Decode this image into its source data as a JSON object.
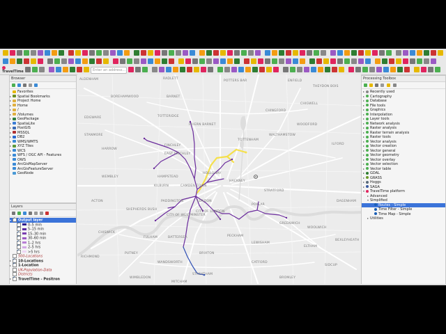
{
  "app": {
    "logo_text": "TravelTime",
    "address_placeholder": "Enter an address..."
  },
  "browser": {
    "title": "Browser",
    "items": [
      {
        "label": "Favorites",
        "icon": "star-icon",
        "color": "#e6b800",
        "arrow": ""
      },
      {
        "label": "Spatial Bookmarks",
        "icon": "bookmark-icon",
        "color": "#6b8e23",
        "arrow": "▸"
      },
      {
        "label": "Project Home",
        "icon": "folder-icon",
        "color": "#e0b040",
        "arrow": "▸"
      },
      {
        "label": "Home",
        "icon": "folder-icon",
        "color": "#e0b040",
        "arrow": "▸"
      },
      {
        "label": "/",
        "icon": "folder-icon",
        "color": "#e0b040",
        "arrow": "▸"
      },
      {
        "label": "/Volumes",
        "icon": "folder-icon",
        "color": "#e0b040",
        "arrow": "▸"
      },
      {
        "label": "GeoPackage",
        "icon": "geopackage-icon",
        "color": "#2f7f3f",
        "arrow": "▸"
      },
      {
        "label": "SpatiaLite",
        "icon": "spatialite-icon",
        "color": "#3a7dd6",
        "arrow": "▸"
      },
      {
        "label": "PostGIS",
        "icon": "elephant-icon",
        "color": "#3a6bb5",
        "arrow": "▸"
      },
      {
        "label": "MSSQL",
        "icon": "database-icon",
        "color": "#b03030",
        "arrow": "▸"
      },
      {
        "label": "DB2",
        "icon": "database-icon",
        "color": "#2a6ad0",
        "arrow": "▸"
      },
      {
        "label": "WMS/WMTS",
        "icon": "globe-icon",
        "color": "#3a8ad6",
        "arrow": "▸"
      },
      {
        "label": "XYZ Tiles",
        "icon": "grid-icon",
        "color": "#5a9a3a",
        "arrow": "▸"
      },
      {
        "label": "WCS",
        "icon": "globe-icon",
        "color": "#3a8ad6",
        "arrow": "▸"
      },
      {
        "label": "WFS / OGC API - Features",
        "icon": "globe-icon",
        "color": "#3a8ad6",
        "arrow": "▸"
      },
      {
        "label": "OWS",
        "icon": "globe-icon",
        "color": "#3a8ad6",
        "arrow": ""
      },
      {
        "label": "ArcGisMapServer",
        "icon": "globe-icon",
        "color": "#3a8ad6",
        "arrow": ""
      },
      {
        "label": "ArcGisFeatureServer",
        "icon": "globe-icon",
        "color": "#3a8ad6",
        "arrow": ""
      },
      {
        "label": "GeoNode",
        "icon": "geonode-icon",
        "color": "#4a9ad6",
        "arrow": ""
      }
    ]
  },
  "layers": {
    "title": "Layers",
    "output_layer": "Output layer",
    "legend": [
      {
        "label": "0–5 min",
        "color": "#2b1a8e"
      },
      {
        "label": "5–15 min",
        "color": "#5a2aa0"
      },
      {
        "label": "15–30 min",
        "color": "#7a3fb0"
      },
      {
        "label": "30–60 min",
        "color": "#9b59c4"
      },
      {
        "label": "1–2 hrs",
        "color": "#b87fd6"
      },
      {
        "label": "2–5 hrs",
        "color": "#d3a8e6"
      },
      {
        "label": ">5 hrs",
        "color": "#eed6f5"
      }
    ],
    "others": [
      {
        "label": "500-Locations",
        "style": "dim",
        "checked": false
      },
      {
        "label": "10-Locations",
        "style": "bold",
        "checked": true
      },
      {
        "label": "1-Location",
        "style": "bold",
        "checked": true
      },
      {
        "label": "UK-Population-Data",
        "style": "dim",
        "checked": false
      },
      {
        "label": "Districts",
        "style": "dim",
        "checked": false
      },
      {
        "label": "TravelTime - Positron",
        "style": "bold",
        "checked": true
      }
    ]
  },
  "toolbox": {
    "title": "Processing Toolbox",
    "items": [
      {
        "label": "Recently used",
        "icon": "clock-icon",
        "color": "#888",
        "indent": 0,
        "arrow": "▸"
      },
      {
        "label": "Cartography",
        "icon": "gear-icon",
        "color": "#4caf50",
        "indent": 0,
        "arrow": "▸"
      },
      {
        "label": "Database",
        "icon": "gear-icon",
        "color": "#4caf50",
        "indent": 0,
        "arrow": "▸"
      },
      {
        "label": "File tools",
        "icon": "gear-icon",
        "color": "#4caf50",
        "indent": 0,
        "arrow": "▸"
      },
      {
        "label": "Graphics",
        "icon": "gear-icon",
        "color": "#4caf50",
        "indent": 0,
        "arrow": "▸"
      },
      {
        "label": "Interpolation",
        "icon": "gear-icon",
        "color": "#4caf50",
        "indent": 0,
        "arrow": "▸"
      },
      {
        "label": "Layer tools",
        "icon": "gear-icon",
        "color": "#4caf50",
        "indent": 0,
        "arrow": "▸"
      },
      {
        "label": "Network analysis",
        "icon": "gear-icon",
        "color": "#4caf50",
        "indent": 0,
        "arrow": "▸"
      },
      {
        "label": "Raster analysis",
        "icon": "gear-icon",
        "color": "#4caf50",
        "indent": 0,
        "arrow": "▸"
      },
      {
        "label": "Raster terrain analysis",
        "icon": "gear-icon",
        "color": "#4caf50",
        "indent": 0,
        "arrow": "▸"
      },
      {
        "label": "Raster tools",
        "icon": "gear-icon",
        "color": "#4caf50",
        "indent": 0,
        "arrow": "▸"
      },
      {
        "label": "Vector analysis",
        "icon": "gear-icon",
        "color": "#4caf50",
        "indent": 0,
        "arrow": "▸"
      },
      {
        "label": "Vector creation",
        "icon": "gear-icon",
        "color": "#4caf50",
        "indent": 0,
        "arrow": "▸"
      },
      {
        "label": "Vector general",
        "icon": "gear-icon",
        "color": "#4caf50",
        "indent": 0,
        "arrow": "▸"
      },
      {
        "label": "Vector geometry",
        "icon": "gear-icon",
        "color": "#4caf50",
        "indent": 0,
        "arrow": "▸"
      },
      {
        "label": "Vector overlay",
        "icon": "gear-icon",
        "color": "#4caf50",
        "indent": 0,
        "arrow": "▸"
      },
      {
        "label": "Vector selection",
        "icon": "gear-icon",
        "color": "#4caf50",
        "indent": 0,
        "arrow": "▸"
      },
      {
        "label": "Vector table",
        "icon": "gear-icon",
        "color": "#4caf50",
        "indent": 0,
        "arrow": "▸"
      },
      {
        "label": "GDAL",
        "icon": "gdal-icon",
        "color": "#2e7d32",
        "indent": 0,
        "arrow": "▸"
      },
      {
        "label": "GRASS",
        "icon": "grass-icon",
        "color": "#6a9a2a",
        "indent": 0,
        "arrow": "▸"
      },
      {
        "label": "Hoggs",
        "icon": "plugin-icon",
        "color": "#5a6a7a",
        "indent": 0,
        "arrow": "▸"
      },
      {
        "label": "SAGA",
        "icon": "saga-icon",
        "color": "#3a5aa0",
        "indent": 0,
        "arrow": "▸"
      },
      {
        "label": "TravelTime platform",
        "icon": "traveltime-icon",
        "color": "#e0245e",
        "indent": 0,
        "arrow": "▾"
      },
      {
        "label": "Advanced",
        "icon": "",
        "color": "",
        "indent": 1,
        "arrow": "▸"
      },
      {
        "label": "Simplified",
        "icon": "",
        "color": "",
        "indent": 1,
        "arrow": "▾"
      },
      {
        "label": "Routes - Simple",
        "icon": "route-icon",
        "color": "#1a5fb4",
        "indent": 2,
        "arrow": "",
        "selected": true
      },
      {
        "label": "Time Filter - Simple",
        "icon": "filter-icon",
        "color": "#1a5fb4",
        "indent": 2,
        "arrow": ""
      },
      {
        "label": "Time Map - Simple",
        "icon": "map-icon",
        "color": "#1a5fb4",
        "indent": 2,
        "arrow": ""
      },
      {
        "label": "Utilities",
        "icon": "",
        "color": "",
        "indent": 1,
        "arrow": "▸"
      }
    ]
  },
  "map": {
    "places": [
      {
        "label": "ALDENHAM"
      },
      {
        "label": "RADLETT"
      },
      {
        "label": "POTTERS BAR"
      },
      {
        "label": "ENFIELD"
      },
      {
        "label": "THEYDON BOIS"
      },
      {
        "label": "BOREHAMWOOD"
      },
      {
        "label": "BARNET"
      },
      {
        "label": "CHIGWELL"
      },
      {
        "label": "TOTTERIDGE"
      },
      {
        "label": "CHINGFORD"
      },
      {
        "label": "EDGWARE"
      },
      {
        "label": "FRIERN BARNET"
      },
      {
        "label": "STANMORE"
      },
      {
        "label": "WOODFORD"
      },
      {
        "label": "HARROW"
      },
      {
        "label": "FINCHLEY"
      },
      {
        "label": "EAST FINCHLEY"
      },
      {
        "label": "TOTTENHAM"
      },
      {
        "label": "WALTHAMSTOW"
      },
      {
        "label": "ILFORD"
      },
      {
        "label": "WEMBLEY"
      },
      {
        "label": "HAMPSTEAD"
      },
      {
        "label": "HOLLOWAY"
      },
      {
        "label": "STRATFORD"
      },
      {
        "label": "HACKNEY"
      },
      {
        "label": "KILBURN"
      },
      {
        "label": "CAMDEN TOWN"
      },
      {
        "label": "ACTON"
      },
      {
        "label": "PADDINGTON"
      },
      {
        "label": "LONDON"
      },
      {
        "label": "SHEPHERDS BUSH"
      },
      {
        "label": "CITY OF WESTMINSTER"
      },
      {
        "label": "CITY OF LONDON"
      },
      {
        "label": "POPLAR"
      },
      {
        "label": "GREENWICH"
      },
      {
        "label": "WOOLWICH"
      },
      {
        "label": "CHISWICK"
      },
      {
        "label": "FULHAM"
      },
      {
        "label": "BATTERSEA"
      },
      {
        "label": "PECKHAM"
      },
      {
        "label": "LEWISHAM"
      },
      {
        "label": "ELTHAM"
      },
      {
        "label": "RICHMOND"
      },
      {
        "label": "PUTNEY"
      },
      {
        "label": "BRIXTON"
      },
      {
        "label": "WANDSWORTH"
      },
      {
        "label": "CATFORD"
      },
      {
        "label": "STREATHAM"
      },
      {
        "label": "SIDCUP"
      },
      {
        "label": "BEXLEYHEATH"
      },
      {
        "label": "WIMBLEDON"
      },
      {
        "label": "MITCHAM"
      },
      {
        "label": "BROMLEY"
      },
      {
        "label": "DAGENHAM"
      }
    ]
  }
}
